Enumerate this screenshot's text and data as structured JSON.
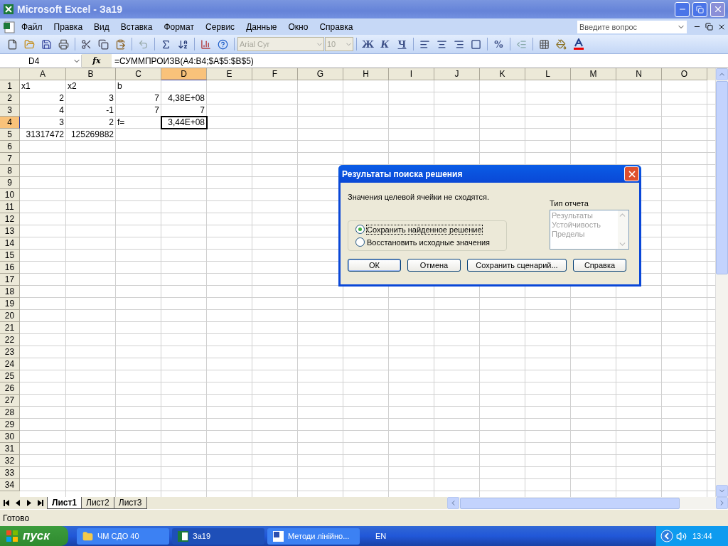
{
  "window": {
    "title": "Microsoft Excel - За19"
  },
  "menu": [
    "Файл",
    "Правка",
    "Вид",
    "Вставка",
    "Формат",
    "Сервис",
    "Данные",
    "Окно",
    "Справка"
  ],
  "help_search": {
    "placeholder": "Введите вопрос"
  },
  "formatting": {
    "font": "Arial Cyr",
    "size": "10",
    "bold": "Ж",
    "italic": "К",
    "underline": "Ч",
    "percent": "%"
  },
  "formula_bar": {
    "name_box": "D4",
    "fx": "fx",
    "formula": "=СУММПРОИЗВ(A4:B4;$A$5:$B$5)"
  },
  "columns": [
    {
      "label": "A",
      "selected": false
    },
    {
      "label": "B",
      "selected": false
    },
    {
      "label": "C",
      "selected": false
    },
    {
      "label": "D",
      "selected": true
    },
    {
      "label": "E",
      "selected": false
    },
    {
      "label": "F",
      "selected": false
    },
    {
      "label": "G",
      "selected": false
    },
    {
      "label": "H",
      "selected": false
    },
    {
      "label": "I",
      "selected": false
    },
    {
      "label": "J",
      "selected": false
    },
    {
      "label": "K",
      "selected": false
    },
    {
      "label": "L",
      "selected": false
    },
    {
      "label": "M",
      "selected": false
    },
    {
      "label": "N",
      "selected": false
    },
    {
      "label": "O",
      "selected": false
    }
  ],
  "rows": [
    {
      "label": "1",
      "selected": false,
      "cells": [
        {
          "text": "x1",
          "kind": "text"
        },
        {
          "text": "x2",
          "kind": "text"
        },
        {
          "text": "b",
          "kind": "text"
        }
      ]
    },
    {
      "label": "2",
      "selected": false,
      "cells": [
        {
          "text": "2",
          "kind": "number"
        },
        {
          "text": "3",
          "kind": "number"
        },
        {
          "text": "7",
          "kind": "number"
        },
        {
          "text": "4,38E+08",
          "kind": "number"
        }
      ]
    },
    {
      "label": "3",
      "selected": false,
      "cells": [
        {
          "text": "4",
          "kind": "number"
        },
        {
          "text": "-1",
          "kind": "number"
        },
        {
          "text": "7",
          "kind": "number"
        },
        {
          "text": "7",
          "kind": "number"
        }
      ]
    },
    {
      "label": "4",
      "selected": true,
      "cells": [
        {
          "text": "3",
          "kind": "number"
        },
        {
          "text": "2",
          "kind": "number"
        },
        {
          "text": "f=",
          "kind": "text"
        },
        {
          "text": "3,44E+08",
          "kind": "number",
          "active": true
        }
      ]
    },
    {
      "label": "5",
      "selected": false,
      "cells": [
        {
          "text": "31317472",
          "kind": "number"
        },
        {
          "text": "125269882",
          "kind": "number"
        }
      ]
    },
    {
      "label": "6",
      "selected": false
    },
    {
      "label": "7",
      "selected": false
    },
    {
      "label": "8",
      "selected": false
    },
    {
      "label": "9",
      "selected": false
    },
    {
      "label": "10",
      "selected": false
    },
    {
      "label": "11",
      "selected": false
    },
    {
      "label": "12",
      "selected": false
    },
    {
      "label": "13",
      "selected": false
    },
    {
      "label": "14",
      "selected": false
    },
    {
      "label": "15",
      "selected": false
    },
    {
      "label": "16",
      "selected": false
    },
    {
      "label": "17",
      "selected": false
    },
    {
      "label": "18",
      "selected": false
    },
    {
      "label": "19",
      "selected": false
    },
    {
      "label": "20",
      "selected": false
    },
    {
      "label": "21",
      "selected": false
    },
    {
      "label": "22",
      "selected": false
    },
    {
      "label": "23",
      "selected": false
    },
    {
      "label": "24",
      "selected": false
    },
    {
      "label": "25",
      "selected": false
    },
    {
      "label": "26",
      "selected": false
    },
    {
      "label": "27",
      "selected": false
    },
    {
      "label": "28",
      "selected": false
    },
    {
      "label": "29",
      "selected": false
    },
    {
      "label": "30",
      "selected": false
    },
    {
      "label": "31",
      "selected": false
    },
    {
      "label": "32",
      "selected": false
    },
    {
      "label": "33",
      "selected": false
    },
    {
      "label": "34",
      "selected": false
    }
  ],
  "sheet_tabs": [
    {
      "label": "Лист1",
      "selected": true
    },
    {
      "label": "Лист2",
      "selected": false
    },
    {
      "label": "Лист3",
      "selected": false
    }
  ],
  "status_bar": "Готово",
  "dialog": {
    "title": "Результаты поиска решения",
    "message": "Значения целевой ячейки не сходятся.",
    "options": [
      {
        "label": "Сохранить найденное решение",
        "selected": true
      },
      {
        "label": "Восстановить исходные значения",
        "selected": false
      }
    ],
    "report_type": {
      "label": "Тип отчета",
      "items": [
        "Результаты",
        "Устойчивость",
        "Пределы"
      ]
    },
    "buttons": [
      {
        "label": "ОК",
        "default": true
      },
      {
        "label": "Отмена",
        "default": false
      },
      {
        "label": "Сохранить сценарий...",
        "default": false
      },
      {
        "label": "Справка",
        "default": false
      }
    ]
  },
  "taskbar": {
    "start": "пуск",
    "tasks": [
      {
        "label": "ЧМ СДО 40",
        "kind": "folder",
        "selected": false
      },
      {
        "label": "За19",
        "kind": "excel",
        "selected": true
      },
      {
        "label": "Методи лінійно...",
        "kind": "word",
        "selected": false
      }
    ],
    "language": "EN",
    "clock": "13:44"
  }
}
